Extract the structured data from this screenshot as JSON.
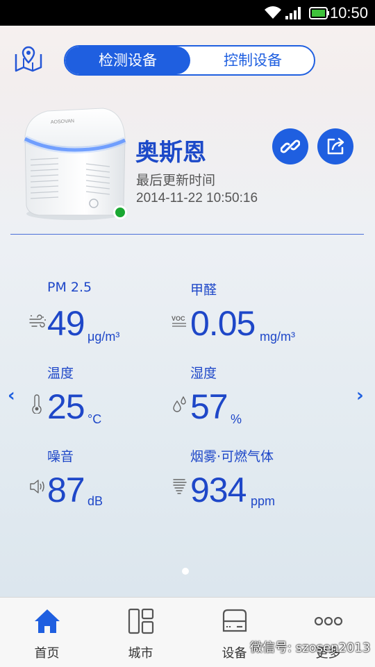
{
  "status_bar": {
    "time": "10:50"
  },
  "header": {
    "tabs": [
      {
        "label": "检测设备",
        "active": true
      },
      {
        "label": "控制设备",
        "active": false
      }
    ]
  },
  "device": {
    "name": "奥斯恩",
    "last_update_label": "最后更新时间",
    "last_update_time": "2014-11-22 10:50:16",
    "online": true
  },
  "metrics": [
    {
      "label": "PM 2.5",
      "value": "49",
      "unit": "μg/m³",
      "icon": "wind-icon"
    },
    {
      "label": "甲醛",
      "value": "0.05",
      "unit": "mg/m³",
      "icon": "voc-icon"
    },
    {
      "label": "温度",
      "value": "25",
      "unit": "°C",
      "icon": "thermometer-icon"
    },
    {
      "label": "湿度",
      "value": "57",
      "unit": "%",
      "icon": "droplet-icon"
    },
    {
      "label": "噪音",
      "value": "87",
      "unit": "dB",
      "icon": "speaker-icon"
    },
    {
      "label": "烟雾·可燃气体",
      "value": "934",
      "unit": "ppm",
      "icon": "smoke-icon"
    }
  ],
  "nav": {
    "prev": "‹",
    "next": "›"
  },
  "tabbar": [
    {
      "label": "首页",
      "icon": "home-icon",
      "active": true
    },
    {
      "label": "城市",
      "icon": "city-icon",
      "active": false
    },
    {
      "label": "设备",
      "icon": "device-icon",
      "active": false
    },
    {
      "label": "更多",
      "icon": "more-icon",
      "active": false
    }
  ],
  "watermark": "微信号: szosen2013",
  "colors": {
    "accent": "#1f5fe0",
    "text": "#1e47c8",
    "online": "#1aa832"
  }
}
